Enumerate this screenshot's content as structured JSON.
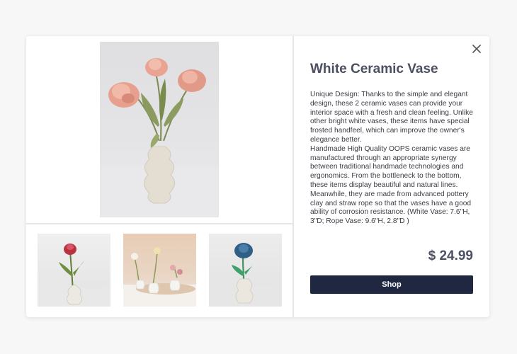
{
  "product": {
    "title": "White Ceramic Vase",
    "description": "Unique Design: Thanks to the simple and elegant design, these 2 ceramic vases can provide your interior space with a fresh and clean feeling. Unlike other bright white vases, these items have special frosted handfeel, which can improve the owner's elegance better.\nHandmade High Quality OOPS ceramic vases are manufactured through an appropriate synergy between traditional handmade technologies and ergonomics. From the bottleneck to the bottom, these items display beautiful and natural lines. Meanwhile, they are made from advanced pottery clay and straw rope so that the vases have a good ability of corrosion resistance. (White Vase: 7.6\"H, 3\"D; Rope Vase: 9.6\"H, 2.8\"D )",
    "price": "$ 24.99",
    "shop_label": "Shop"
  },
  "icons": {
    "close": "close-icon"
  },
  "colors": {
    "button_bg": "#1f2840",
    "title_color": "#4d5060"
  }
}
